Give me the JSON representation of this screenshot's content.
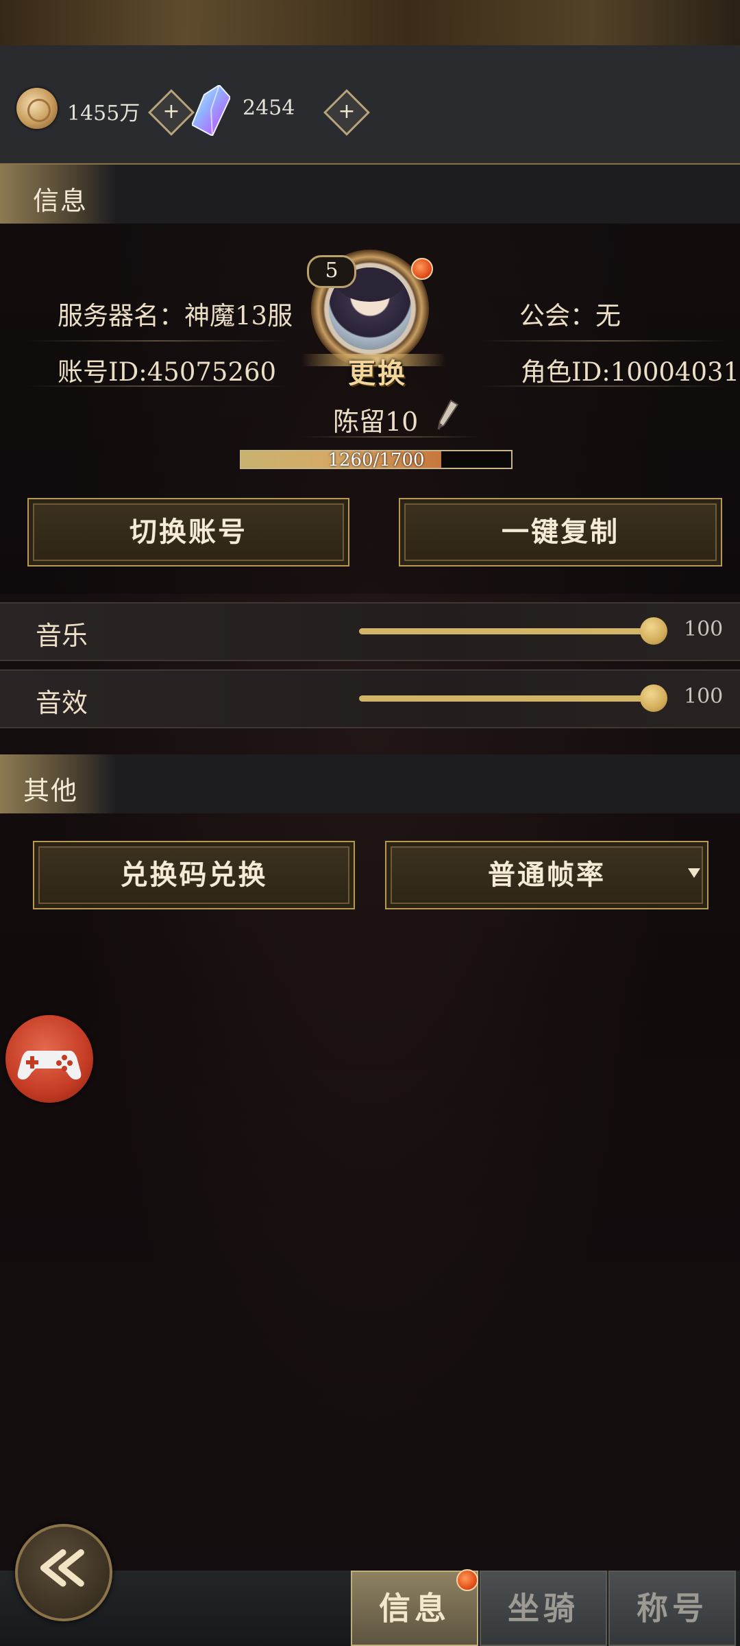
{
  "currency": {
    "coins": "1455万",
    "crystals": "2454"
  },
  "info_section": {
    "header": "信息",
    "server": "服务器名：神魔13服",
    "guild": "公会：无",
    "account_id": "账号ID:45075260",
    "role_id": "角色ID:10004031",
    "level": "5",
    "change_label": "更换",
    "player_name": "陈留10",
    "exp_text": "1260/1700",
    "exp_fraction": 0.741,
    "switch_account": "切换账号",
    "copy_all": "一键复制"
  },
  "audio": {
    "music_label": "音乐",
    "music_value": "100",
    "sfx_label": "音效",
    "sfx_value": "100"
  },
  "other_section": {
    "header": "其他",
    "redeem_code": "兑换码兑换",
    "frame_rate": "普通帧率"
  },
  "bottom_nav": {
    "tabs": [
      {
        "label": "信息",
        "active": true
      },
      {
        "label": "坐骑",
        "active": false
      },
      {
        "label": "称号",
        "active": false
      }
    ]
  },
  "colors": {
    "accent_gold": "#c9a75b",
    "badge_red": "#e4511c"
  },
  "icons": {
    "coin": "coin-icon",
    "crystal": "crystal-icon",
    "add": "plus-icon",
    "edit": "pen-icon",
    "gamepad": "gamepad-icon",
    "back": "double-chevron-left-icon",
    "dropdown": "triangle-down-icon"
  }
}
